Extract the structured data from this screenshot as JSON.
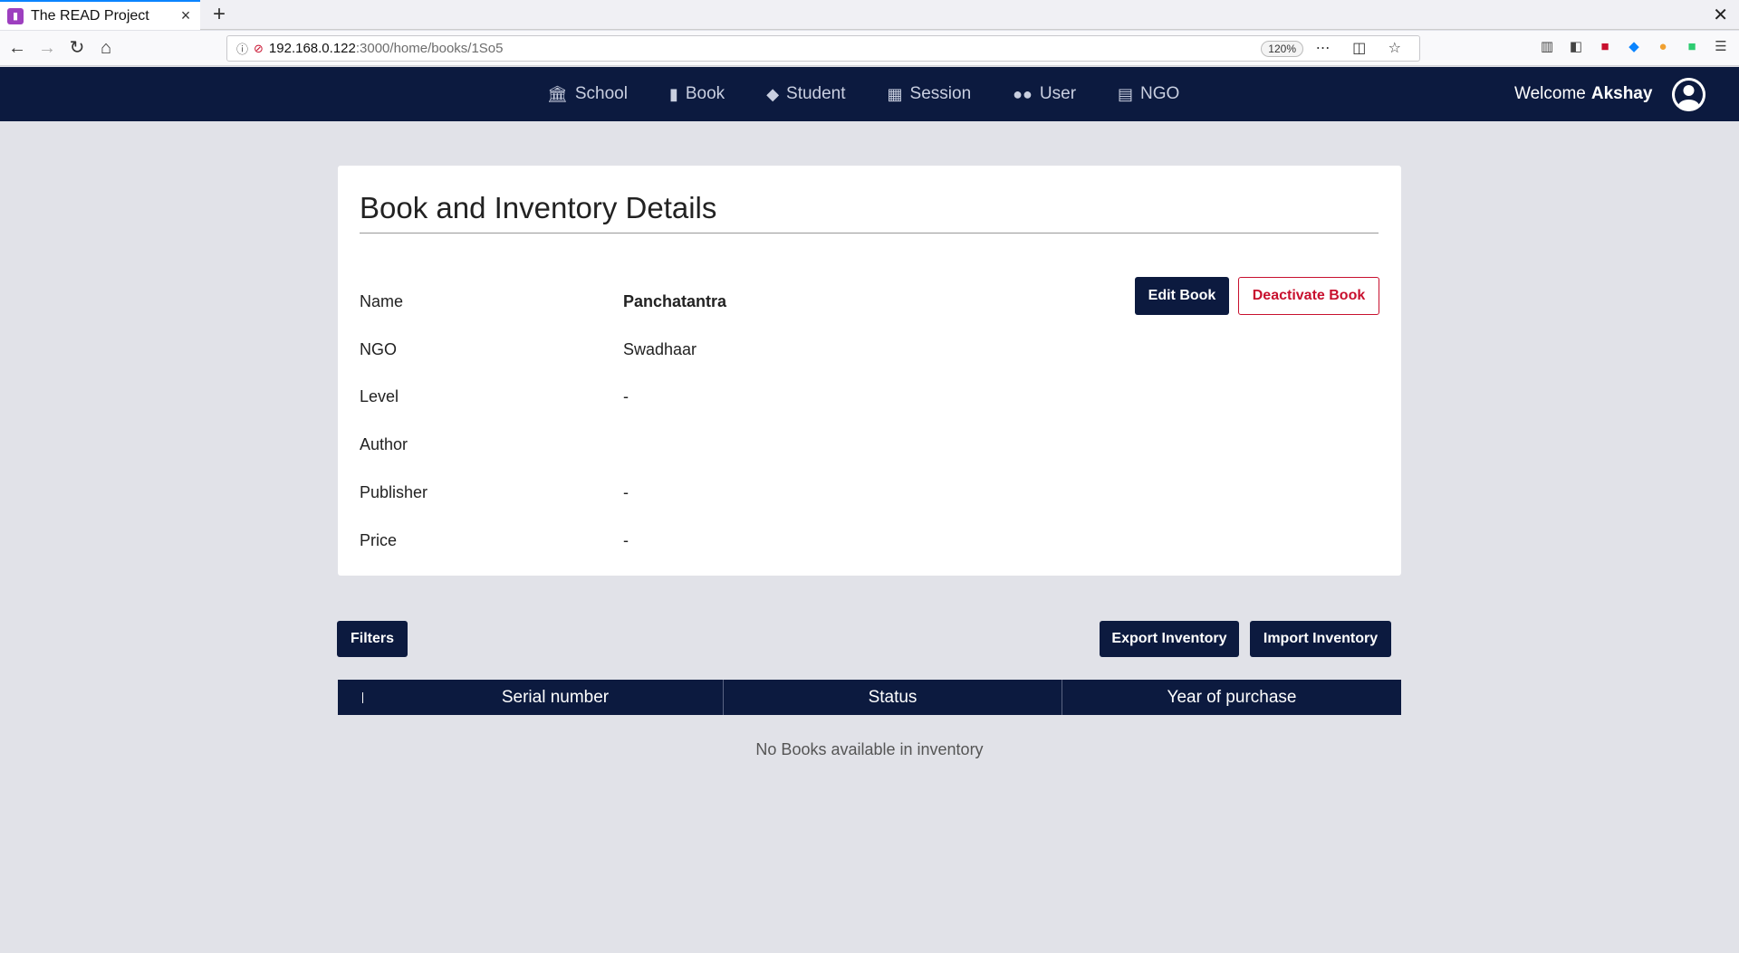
{
  "browser": {
    "tab_title": "The READ Project",
    "new_tab": "+",
    "url_host": "192.168.0.122",
    "url_path": ":3000/home/books/1So5",
    "zoom": "120%"
  },
  "header": {
    "menu": [
      {
        "label": "School",
        "icon": "bank-icon"
      },
      {
        "label": "Book",
        "icon": "book-icon"
      },
      {
        "label": "Student",
        "icon": "graduation-cap-icon"
      },
      {
        "label": "Session",
        "icon": "calendar-icon"
      },
      {
        "label": "User",
        "icon": "users-icon"
      },
      {
        "label": "NGO",
        "icon": "building-icon"
      }
    ],
    "welcome_text": "Welcome",
    "user_name": "Akshay"
  },
  "card": {
    "title": "Book and Inventory Details",
    "details": [
      {
        "label": "Name",
        "value": "Panchatantra"
      },
      {
        "label": "NGO",
        "value": "Swadhaar"
      },
      {
        "label": "Level",
        "value": "-"
      },
      {
        "label": "Author",
        "value": ""
      },
      {
        "label": "Publisher",
        "value": "-"
      },
      {
        "label": "Price",
        "value": "-"
      }
    ],
    "edit_label": "Edit Book",
    "deactivate_label": "Deactivate Book"
  },
  "actions": {
    "filters_label": "Filters",
    "export_label": "Export Inventory",
    "import_label": "Import Inventory"
  },
  "table": {
    "columns": [
      "Serial number",
      "Status",
      "Year of purchase"
    ],
    "empty_message": "No Books available in inventory"
  },
  "colors": {
    "primary": "#0c1a3f",
    "danger": "#c8102e",
    "background": "#e1e2e8"
  }
}
